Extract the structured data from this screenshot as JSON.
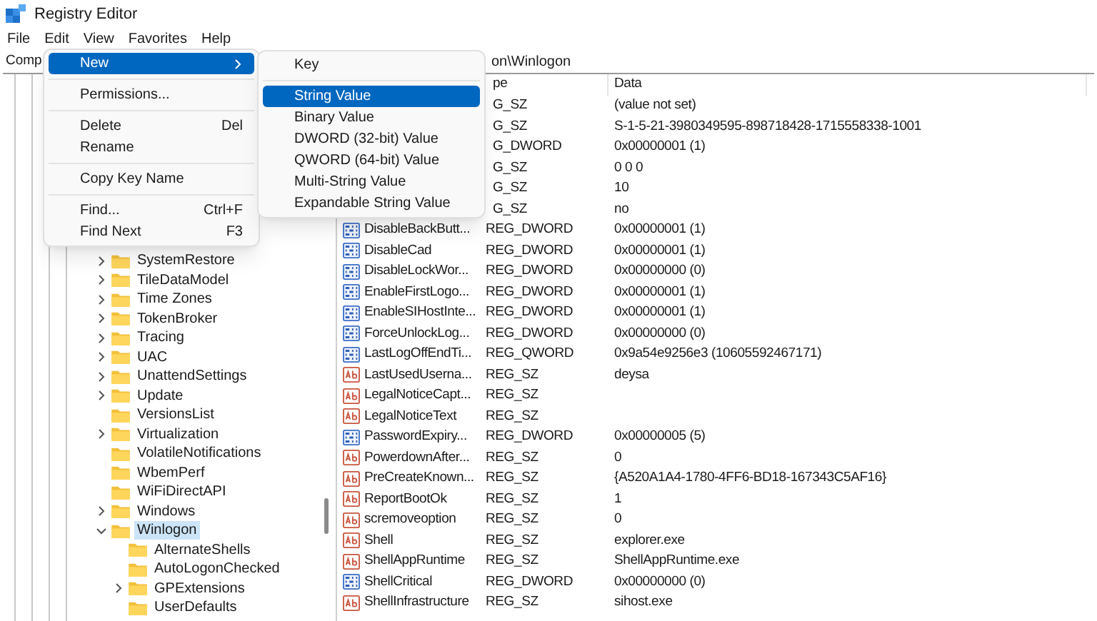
{
  "window": {
    "title": "Registry Editor"
  },
  "menubar": [
    "File",
    "Edit",
    "View",
    "Favorites",
    "Help"
  ],
  "address": {
    "left": "Comp",
    "right": "on\\Winlogon"
  },
  "edit_menu": [
    {
      "label": "New",
      "submenu": true,
      "selected": true,
      "separator_after": true
    },
    {
      "label": "Permissions...",
      "submenu": false,
      "selected": false,
      "separator_after": true
    },
    {
      "label": "Delete",
      "shortcut": "Del",
      "submenu": false,
      "selected": false,
      "separator_after": false
    },
    {
      "label": "Rename",
      "submenu": false,
      "selected": false,
      "separator_after": true
    },
    {
      "label": "Copy Key Name",
      "submenu": false,
      "selected": false,
      "separator_after": true
    },
    {
      "label": "Find...",
      "shortcut": "Ctrl+F",
      "submenu": false,
      "selected": false,
      "separator_after": false
    },
    {
      "label": "Find Next",
      "shortcut": "F3",
      "submenu": false,
      "selected": false,
      "separator_after": false
    }
  ],
  "new_submenu": [
    {
      "label": "Key",
      "submenu": false,
      "selected": false,
      "separator_after": true
    },
    {
      "label": "String Value",
      "submenu": false,
      "selected": true,
      "separator_after": false
    },
    {
      "label": "Binary Value",
      "submenu": false,
      "selected": false,
      "separator_after": false
    },
    {
      "label": "DWORD (32-bit) Value",
      "submenu": false,
      "selected": false,
      "separator_after": false
    },
    {
      "label": "QWORD (64-bit) Value",
      "submenu": false,
      "selected": false,
      "separator_after": false
    },
    {
      "label": "Multi-String Value",
      "submenu": false,
      "selected": false,
      "separator_after": false
    },
    {
      "label": "Expandable String Value",
      "submenu": false,
      "selected": false,
      "separator_after": false
    }
  ],
  "tree": [
    {
      "label": "SystemRestore",
      "has_children": true,
      "expanded": false,
      "selected": false
    },
    {
      "label": "TileDataModel",
      "has_children": true,
      "expanded": false,
      "selected": false
    },
    {
      "label": "Time Zones",
      "has_children": true,
      "expanded": false,
      "selected": false
    },
    {
      "label": "TokenBroker",
      "has_children": true,
      "expanded": false,
      "selected": false
    },
    {
      "label": "Tracing",
      "has_children": true,
      "expanded": false,
      "selected": false
    },
    {
      "label": "UAC",
      "has_children": true,
      "expanded": false,
      "selected": false
    },
    {
      "label": "UnattendSettings",
      "has_children": true,
      "expanded": false,
      "selected": false
    },
    {
      "label": "Update",
      "has_children": true,
      "expanded": false,
      "selected": false
    },
    {
      "label": "VersionsList",
      "has_children": false,
      "selected": false
    },
    {
      "label": "Virtualization",
      "has_children": true,
      "expanded": false,
      "selected": false
    },
    {
      "label": "VolatileNotifications",
      "has_children": false,
      "selected": false
    },
    {
      "label": "WbemPerf",
      "has_children": false,
      "selected": false
    },
    {
      "label": "WiFiDirectAPI",
      "has_children": false,
      "selected": false
    },
    {
      "label": "Windows",
      "has_children": true,
      "expanded": false,
      "selected": false
    },
    {
      "label": "Winlogon",
      "has_children": true,
      "expanded": true,
      "selected": true,
      "children": [
        {
          "label": "AlternateShells",
          "has_children": false,
          "selected": false
        },
        {
          "label": "AutoLogonChecked",
          "has_children": false,
          "selected": false
        },
        {
          "label": "GPExtensions",
          "has_children": true,
          "expanded": false,
          "selected": false
        },
        {
          "label": "UserDefaults",
          "has_children": false,
          "selected": false
        }
      ]
    }
  ],
  "table": {
    "columns": [
      "pe",
      "Data"
    ],
    "rows": [
      {
        "type": "G_SZ",
        "data": "(value not set)"
      },
      {
        "type": "G_SZ",
        "data": "S-1-5-21-3980349595-898718428-1715558338-1001"
      },
      {
        "type": "G_DWORD",
        "data": "0x00000001 (1)"
      },
      {
        "type": "G_SZ",
        "data": "0 0 0"
      },
      {
        "type": "G_SZ",
        "data": "10"
      },
      {
        "type": "G_SZ",
        "data": "no"
      },
      {
        "kind": "binary",
        "name": "DisableBackButt...",
        "type": "REG_DWORD",
        "data": "0x00000001 (1)"
      },
      {
        "kind": "binary",
        "name": "DisableCad",
        "type": "REG_DWORD",
        "data": "0x00000001 (1)"
      },
      {
        "kind": "binary",
        "name": "DisableLockWor...",
        "type": "REG_DWORD",
        "data": "0x00000000 (0)"
      },
      {
        "kind": "binary",
        "name": "EnableFirstLogo...",
        "type": "REG_DWORD",
        "data": "0x00000001 (1)"
      },
      {
        "kind": "binary",
        "name": "EnableSIHostInte...",
        "type": "REG_DWORD",
        "data": "0x00000001 (1)"
      },
      {
        "kind": "binary",
        "name": "ForceUnlockLog...",
        "type": "REG_DWORD",
        "data": "0x00000000 (0)"
      },
      {
        "kind": "binary",
        "name": "LastLogOffEndTi...",
        "type": "REG_QWORD",
        "data": "0x9a54e9256e3 (10605592467171)"
      },
      {
        "kind": "string",
        "name": "LastUsedUserna...",
        "type": "REG_SZ",
        "data": "deysa"
      },
      {
        "kind": "string",
        "name": "LegalNoticeCapt...",
        "type": "REG_SZ"
      },
      {
        "kind": "string",
        "name": "LegalNoticeText",
        "type": "REG_SZ"
      },
      {
        "kind": "binary",
        "name": "PasswordExpiry...",
        "type": "REG_DWORD",
        "data": "0x00000005 (5)"
      },
      {
        "kind": "string",
        "name": "PowerdownAfter...",
        "type": "REG_SZ",
        "data": "0"
      },
      {
        "kind": "string",
        "name": "PreCreateKnown...",
        "type": "REG_SZ",
        "data": "{A520A1A4-1780-4FF6-BD18-167343C5AF16}"
      },
      {
        "kind": "string",
        "name": "ReportBootOk",
        "type": "REG_SZ",
        "data": "1"
      },
      {
        "kind": "string",
        "name": "scremoveoption",
        "type": "REG_SZ",
        "data": "0"
      },
      {
        "kind": "string",
        "name": "Shell",
        "type": "REG_SZ",
        "data": "explorer.exe"
      },
      {
        "kind": "string",
        "name": "ShellAppRuntime",
        "type": "REG_SZ",
        "data": "ShellAppRuntime.exe"
      },
      {
        "kind": "binary",
        "name": "ShellCritical",
        "type": "REG_DWORD",
        "data": "0x00000000 (0)"
      },
      {
        "kind": "string",
        "name": "ShellInfrastructure",
        "type": "REG_SZ",
        "data": "sihost.exe"
      }
    ]
  }
}
